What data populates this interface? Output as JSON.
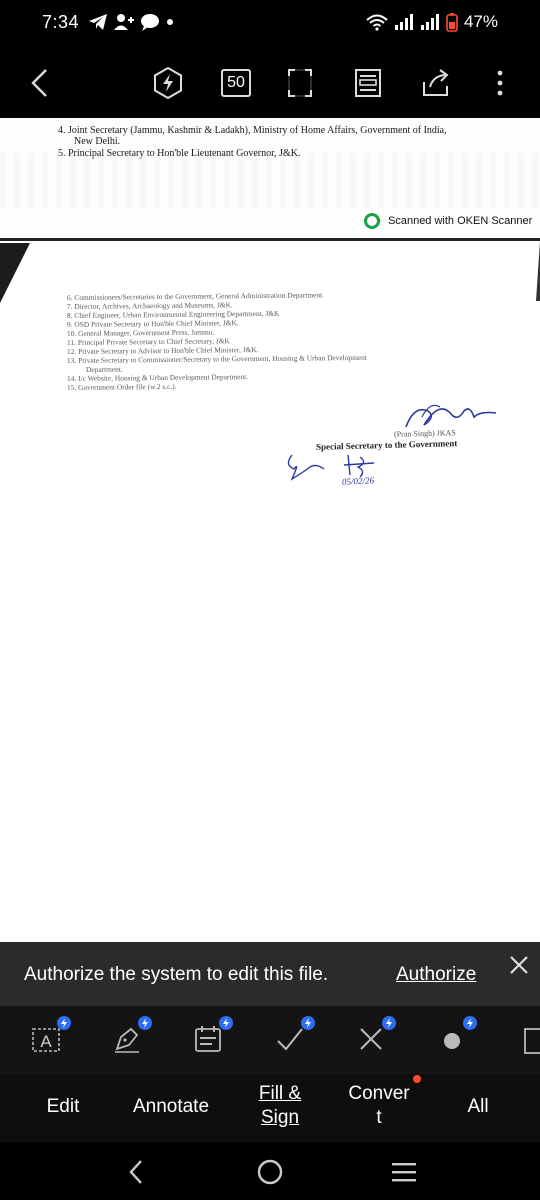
{
  "status_bar": {
    "time": "7:34",
    "battery": "47%"
  },
  "toolbar": {
    "page_count": "50"
  },
  "document": {
    "page1": {
      "lines": [
        "4.  Joint Secretary (Jammu, Kashmir & Ladakh), Ministry of Home Affairs, Government of India,",
        "New Delhi.",
        "5.  Principal Secretary to Hon'ble Lieutenant Governor, J&K."
      ],
      "scanned_tag": "Scanned with OKEN Scanner"
    },
    "page2": {
      "lines": [
        "6.  Commissioners/Secretaries to the Government, General Administration Department.",
        "7.  Director, Archives, Archaeology and Museums, J&K.",
        "8.  Chief Engineer, Urban Environmental Engineering Department, J&K",
        "9.  OSD Private Secretary to Hon'ble Chief Minister, J&K.",
        "10. General Manager, Government Press, Jammu.",
        "11. Principal Private Secretary to Chief Secretary, J&K",
        "12. Private Secretary to Advisor to Hon'ble Chief Minister, J&K.",
        "13. Private Secretary to Commissioner/Secretary to the Government, Housing & Urban Development",
        "Department.",
        "14. I/c Website, Housing & Urban Development Department.",
        "15. Government Order file (w.2 s.c.)."
      ],
      "signatory_name": "(Pran Singh) JKAS",
      "signatory_title": "Special Secretary to the Government",
      "handwritten_date": "05/02/26"
    }
  },
  "auth_banner": {
    "message": "Authorize the system to edit this file.",
    "button": "Authorize"
  },
  "tabs": [
    {
      "label": "Edit"
    },
    {
      "label": "Annotate"
    },
    {
      "label_line1": "Fill &",
      "label_line2": "Sign"
    },
    {
      "label_line1": "Conver",
      "label_line2": "t"
    },
    {
      "label": "All"
    }
  ],
  "colors": {
    "badge": "#2c6df2",
    "notification_dot": "#ff4a2e",
    "scanner_logo": "#1aa14a",
    "banner_bg": "#2b2b2b"
  }
}
